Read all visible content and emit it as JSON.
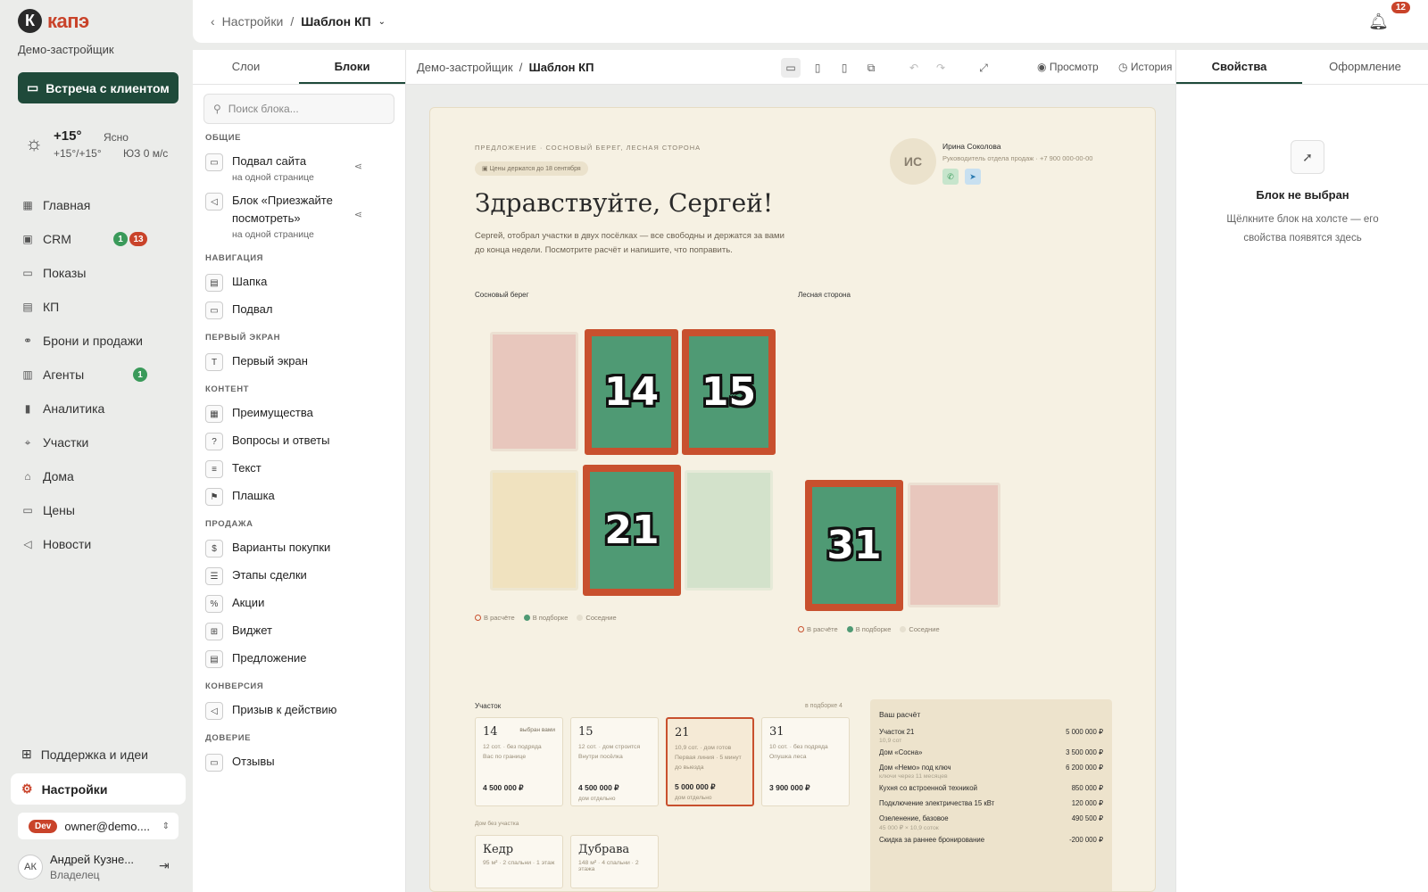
{
  "sidebar": {
    "logo_letter": "К",
    "logo_text": "капэ",
    "company": "Демо-застройщик",
    "meeting_button": "Встреча с клиентом",
    "weather": {
      "temp": "+15°",
      "condition": "Ясно",
      "range": "+15°/+15°",
      "wind": "ЮЗ 0 м/с"
    },
    "nav": [
      {
        "label": "Главная",
        "icon": "grid-icon"
      },
      {
        "label": "CRM",
        "icon": "contact-icon",
        "badges": [
          "1",
          "13"
        ]
      },
      {
        "label": "Показы",
        "icon": "screen-icon"
      },
      {
        "label": "КП",
        "icon": "document-icon"
      },
      {
        "label": "Брони и продажи",
        "icon": "handshake-icon"
      },
      {
        "label": "Агенты",
        "icon": "briefcase-icon",
        "badges": [
          "1"
        ]
      },
      {
        "label": "Аналитика",
        "icon": "chart-icon"
      },
      {
        "label": "Участки",
        "icon": "land-icon"
      },
      {
        "label": "Дома",
        "icon": "house-icon"
      },
      {
        "label": "Цены",
        "icon": "price-icon"
      },
      {
        "label": "Новости",
        "icon": "megaphone-icon"
      }
    ],
    "support": "Поддержка и идеи",
    "settings": "Настройки",
    "account": {
      "badge": "Dev",
      "email": "owner@demo...."
    },
    "user": {
      "initials": "АК",
      "name": "Андрей Кузне...",
      "role": "Владелец"
    }
  },
  "topbar": {
    "back": "Настройки",
    "separator": "/",
    "title": "Шаблон КП",
    "notifications": "12"
  },
  "blocks_panel": {
    "tabs": [
      "Слои",
      "Блоки"
    ],
    "search_placeholder": "Поиск блока...",
    "sections": {
      "general": "ОБЩИЕ",
      "navigation": "НАВИГАЦИЯ",
      "first_screen": "ПЕРВЫЙ ЭКРАН",
      "content": "КОНТЕНТ",
      "sale": "ПРОДАЖА",
      "conversion": "КОНВЕРСИЯ",
      "trust": "ДОВЕРИЕ"
    },
    "items": {
      "footer_site": "Подвал сайта",
      "footer_site_sub": "на одной странице",
      "visit_block": "Блок «Приезжайте посмотреть»",
      "visit_block_sub": "на одной странице",
      "header": "Шапка",
      "footer": "Подвал",
      "first_screen": "Первый экран",
      "advantages": "Преимущества",
      "faq": "Вопросы и ответы",
      "text": "Текст",
      "plate": "Плашка",
      "purchase": "Варианты покупки",
      "stages": "Этапы сделки",
      "promo": "Акции",
      "widget": "Виджет",
      "offer": "Предложение",
      "cta": "Призыв к действию",
      "reviews": "Отзывы"
    }
  },
  "editor": {
    "breadcrumb": {
      "root": "Демо-застройщик",
      "sep": "/",
      "page": "Шаблон КП"
    },
    "preview": "Просмотр",
    "history": "История"
  },
  "canvas": {
    "eyebrow": "ПРЕДЛОЖЕНИЕ · СОСНОВЫЙ БЕРЕГ, ЛЕСНАЯ СТОРОНА",
    "pill": "Цены держатся до 18 сентября",
    "greeting": "Здравствуйте, Сергей!",
    "intro": "Сергей, отобрал участки в двух посёлках — все свободны и держатся за вами до конца недели. Посмотрите расчёт и напишите, что поправить.",
    "manager": {
      "initials": "ИС",
      "name": "Ирина Соколова",
      "role": "Руководитель отдела продаж · +7 900 000-00-00"
    },
    "area1": "Сосновый берег",
    "area2": "Лесная сторона",
    "plot_numbers": [
      "14",
      "15",
      "21",
      "31"
    ],
    "legend": {
      "calc": "В расчёте",
      "selected": "В подборке",
      "neighbor": "Соседние"
    },
    "plots_title": "Участок",
    "plots_count": "в подборке 4",
    "plots": [
      {
        "n": "14",
        "tag": "выбран вами",
        "d1": "12 сот. · без подряда",
        "d2": "Вас по границе",
        "price": "4 500 000 ₽",
        "sub": ""
      },
      {
        "n": "15",
        "tag": "",
        "d1": "12 сот. · дом строится",
        "d2": "Внутри посёлка",
        "price": "4 500 000 ₽",
        "sub": "дом отдельно"
      },
      {
        "n": "21",
        "tag": "",
        "d1": "10,9 сот. · дом готов",
        "d2": "Первая линия · 5 минут до выезда",
        "price": "5 000 000 ₽",
        "sub": "дом отдельно"
      },
      {
        "n": "31",
        "tag": "",
        "d1": "10 сот. · без подряда",
        "d2": "Опушка леса",
        "price": "3 900 000 ₽",
        "sub": ""
      }
    ],
    "houses_label": "Дом без участка",
    "houses": [
      {
        "n": "Кедр",
        "d": "95 м² · 2 спальни · 1 этаж"
      },
      {
        "n": "Дубрава",
        "d": "148 м² · 4 спальни · 2 этажа"
      }
    ],
    "calc": {
      "title": "Ваш расчёт",
      "rows": [
        {
          "l": "Участок 21",
          "v": "5 000 000 ₽",
          "s": "10,9 сот"
        },
        {
          "l": "Дом «Сосна»",
          "v": "3 500 000 ₽",
          "s": ""
        },
        {
          "l": "Дом «Немо» под ключ",
          "v": "6 200 000 ₽",
          "s": "ключи через 11 месяцев"
        },
        {
          "l": "Кухня со встроенной техникой",
          "v": "850 000 ₽",
          "s": ""
        },
        {
          "l": "Подключение электричества 15 кВт",
          "v": "120 000 ₽",
          "s": ""
        },
        {
          "l": "Озеленение, базовое",
          "v": "490 500 ₽",
          "s": "45 000 ₽ × 10,9 соток"
        },
        {
          "l": "Скидка за раннее бронирование",
          "v": "-200 000 ₽",
          "s": ""
        }
      ]
    }
  },
  "props": {
    "tabs": [
      "Свойства",
      "Оформление"
    ],
    "empty_title": "Блок не выбран",
    "empty_desc": "Щёлкните блок на холсте — его свойства появятся здесь"
  },
  "colors": {
    "brand_dark": "#1f4a3a",
    "accent_red": "#c9432a",
    "canvas_bg": "#f6f1e3",
    "selected_plot": "#4f9a74"
  }
}
